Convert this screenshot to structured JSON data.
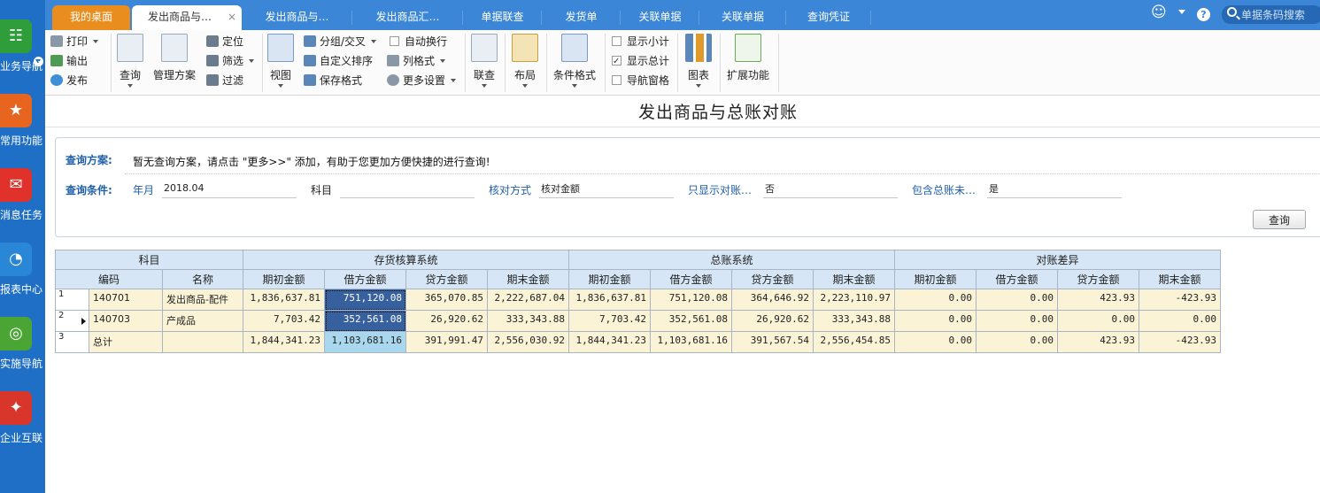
{
  "leftnav": {
    "items": [
      {
        "label": "业务导航",
        "icon": "business-nav-icon",
        "color": "#2f9e3a"
      },
      {
        "label": "常用功能",
        "icon": "star-icon",
        "color": "#e8651f"
      },
      {
        "label": "消息任务",
        "icon": "message-icon",
        "color": "#e0322a"
      },
      {
        "label": "报表中心",
        "icon": "report-icon",
        "color": "#2a86d6"
      },
      {
        "label": "实施导航",
        "icon": "compass-icon",
        "color": "#4aa534"
      },
      {
        "label": "企业互联",
        "icon": "network-icon",
        "color": "#d8362a"
      }
    ]
  },
  "tabs": [
    {
      "label": "我的桌面"
    },
    {
      "label": "发出商品与…"
    },
    {
      "label": "发出商品与…"
    },
    {
      "label": "发出商品汇…"
    },
    {
      "label": "单据联查"
    },
    {
      "label": "发货单"
    },
    {
      "label": "关联单据"
    },
    {
      "label": "关联单据"
    },
    {
      "label": "查询凭证"
    }
  ],
  "header": {
    "close_glyph": "×",
    "smiley_glyph": "☺",
    "help_glyph": "?",
    "search_placeholder": "单据条码搜索"
  },
  "ribbon": {
    "print": "打印",
    "export": "输出",
    "publish": "发布",
    "query": "查询",
    "manage_scheme": "管理方案",
    "locate": "定位",
    "filter": "筛选",
    "filter2": "过滤",
    "view": "视图",
    "group": "分组/交叉",
    "custom_sort": "自定义排序",
    "save_format": "保存格式",
    "auto_wrap": "自动换行",
    "column_format": "列格式",
    "more_settings": "更多设置",
    "link_query": "联查",
    "layout": "布局",
    "cond_format": "条件格式",
    "show_subtotal": "显示小计",
    "show_total": "显示总计",
    "nav_pane": "导航窗格",
    "chart": "图表",
    "extend": "扩展功能",
    "show_subtotal_checked": false,
    "show_total_checked": true,
    "nav_pane_checked": false
  },
  "page_title": "发出商品与总账对账",
  "query_panel": {
    "scheme_label": "查询方案:",
    "scheme_text": "暂无查询方案，请点击 \"更多>>\" 添加，有助于您更加方便快捷的进行查询!",
    "cond_label": "查询条件:",
    "year_month_label": "年月",
    "year_month_value": "2018.04",
    "subject_label": "科目",
    "subject_value": "",
    "check_method_label": "核对方式",
    "check_method_value": "核对金额",
    "only_show_label": "只显示对账…",
    "only_show_value": "否",
    "include_label": "包含总账未…",
    "include_value": "是",
    "query_button": "查询"
  },
  "grid": {
    "group_headers": [
      "科目",
      "存货核算系统",
      "总账系统",
      "对账差异"
    ],
    "columns": [
      "编码",
      "名称",
      "期初金额",
      "借方金额",
      "贷方金额",
      "期末金额",
      "期初金额",
      "借方金额",
      "贷方金额",
      "期末金额",
      "期初金额",
      "借方金额",
      "贷方金额",
      "期末金额"
    ],
    "rows": [
      {
        "no": "1",
        "cells": [
          "140701",
          "发出商品-配件",
          "1,836,637.81",
          "751,120.08",
          "365,070.85",
          "2,222,687.04",
          "1,836,637.81",
          "751,120.08",
          "364,646.92",
          "2,223,110.97",
          "0.00",
          "0.00",
          "423.93",
          "-423.93"
        ]
      },
      {
        "no": "2",
        "cells": [
          "140703",
          "产成品",
          "7,703.42",
          "352,561.08",
          "26,920.62",
          "333,343.88",
          "7,703.42",
          "352,561.08",
          "26,920.62",
          "333,343.88",
          "0.00",
          "0.00",
          "0.00",
          "0.00"
        ]
      },
      {
        "no": "3",
        "cells": [
          "总计",
          "",
          "1,844,341.23",
          "1,103,681.16",
          "391,991.47",
          "2,556,030.92",
          "1,844,341.23",
          "1,103,681.16",
          "391,567.54",
          "2,556,454.85",
          "0.00",
          "0.00",
          "423.93",
          "-423.93"
        ]
      }
    ]
  }
}
